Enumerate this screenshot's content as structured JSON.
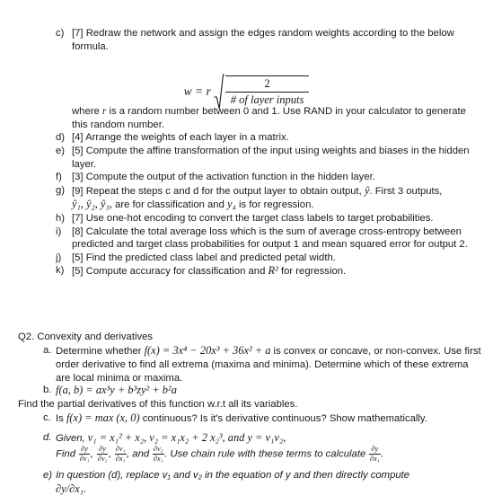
{
  "document": {
    "q1_items": [
      {
        "marker": "c)",
        "text": "[7] Redraw the network and assign the edges random weights according to the below formula."
      },
      {
        "marker": "d)",
        "text": "[4] Arrange the weights of each layer in a matrix."
      },
      {
        "marker": "e)",
        "text": "[5] Compute the affine transformation of the input using weights and biases in the hidden layer."
      },
      {
        "marker": "f)",
        "text": "[3] Compute the output of the activation function in the hidden layer."
      },
      {
        "marker": "g)",
        "text_part1": "[9] Repeat the steps c and d for the output layer to obtain output, ",
        "symbol": "ŷ",
        "text_part2": ". First 3 outputs,",
        "line2_symbols": "ŷ₁, ŷ₂, ŷ₃,",
        "line2_text": " are for classification and ",
        "line2_symbol2": "y₄",
        "line2_text2": " is for regression."
      },
      {
        "marker": "h)",
        "text": "[7] Use one-hot encoding to convert the target class labels to target probabilities."
      },
      {
        "marker": "i)",
        "text": "[8] Calculate the total average loss which is the sum of average cross-entropy between predicted and target class probabilities for output 1 and mean squared error for output 2."
      },
      {
        "marker": "j)",
        "text": "[5] Find the predicted class label and predicted petal width."
      },
      {
        "marker": "k)",
        "text_part1": "[5] Compute accuracy for classification and ",
        "symbol": "R²",
        "text_part2": " for regression."
      }
    ],
    "formula": {
      "lhs": "w = r",
      "numerator": "2",
      "denominator": "# of layer inputs"
    },
    "formula_note": "where r is a random number between 0 and 1. Use RAND in your calculator to generate this random number.",
    "formula_note_var": "r",
    "q2": {
      "heading": "Q2. Convexity and derivatives",
      "items": [
        {
          "marker": "a.",
          "lead": "Determine whether ",
          "equation": "f(x) = 3x⁴ − 20x³ + 36x² + a",
          "tail": " is convex or concave, or non-convex. Use first order derivative to find all extrema (maxima and minima). Determine which of these extrema are local minima or maxima."
        },
        {
          "marker": "b.",
          "equation": "f(a, b) = ax³y + b³zy² + b²a"
        },
        {
          "marker": "c.",
          "lead": "Is ",
          "equation": "f(x) = max (x, 0)",
          "tail": " continuous? Is it's derivative continuous? Show mathematically."
        },
        {
          "marker": "d.",
          "line1_lead": "Given, ",
          "line1_eq": "v₁ = x₁² + x₂, v₂ = x₁x₂ + 2 x₂³, and y = v₁v₂,",
          "line2_lead": "Find ",
          "line2_frac1_num": "∂y",
          "line2_frac1_den": "∂v₁",
          "line2_frac2_num": "∂y",
          "line2_frac2_den": "∂v₂",
          "line2_frac3_num": "∂v₁",
          "line2_frac3_den": "∂x₁",
          "line2_and": " and ",
          "line2_frac4_num": "∂v₂",
          "line2_frac4_den": "∂x₁",
          "line2_tail": ". Use chain rule with these terms to calculate ",
          "line2_frac5_num": "∂y",
          "line2_frac5_den": "∂x₁",
          "line2_end": "."
        },
        {
          "marker": "e)",
          "line1": "In question (d), replace v₁ and v₂ in the equation of y and then directly compute",
          "line2": "∂y/∂x₁."
        }
      ],
      "interline_note": "Find the partial derivatives of this function w.r.t all its variables."
    }
  }
}
